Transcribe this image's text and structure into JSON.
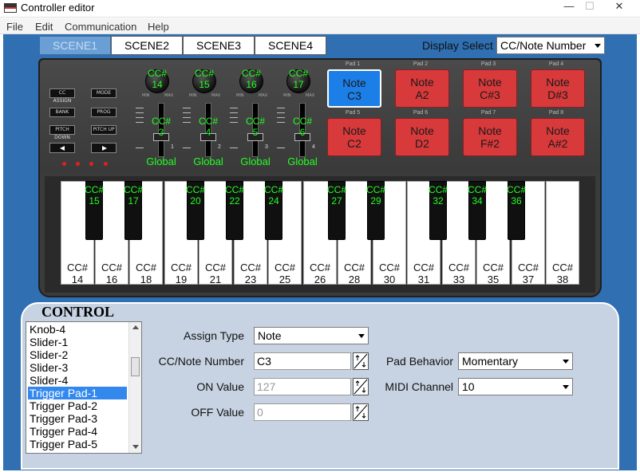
{
  "window": {
    "title": "Controller editor",
    "minimize": "—",
    "maximize": "☐",
    "close": "✕"
  },
  "menu": [
    "File",
    "Edit",
    "Communication",
    "Help"
  ],
  "scenes": [
    "SCENE1",
    "SCENE2",
    "SCENE3",
    "SCENE4"
  ],
  "display_select": {
    "label": "Display Select",
    "value": "CC/Note Number"
  },
  "device": {
    "buttons": [
      "CC ASSIGN",
      "MODE",
      "BANK",
      "PROG",
      "PITCH DOWN",
      "PITCH UP"
    ],
    "knobs": [
      {
        "cc": "CC#",
        "num": "14"
      },
      {
        "cc": "CC#",
        "num": "15"
      },
      {
        "cc": "CC#",
        "num": "16"
      },
      {
        "cc": "CC#",
        "num": "17"
      }
    ],
    "knob_minmax": {
      "min": "MIN",
      "max": "MAX"
    },
    "sliders": [
      {
        "cc": "CC#",
        "num": "3",
        "global": "Global",
        "index": "1"
      },
      {
        "cc": "CC#",
        "num": "4",
        "global": "Global",
        "index": "2"
      },
      {
        "cc": "CC#",
        "num": "5",
        "global": "Global",
        "index": "3"
      },
      {
        "cc": "CC#",
        "num": "6",
        "global": "Global",
        "index": "4"
      }
    ],
    "pads": [
      {
        "label": "Pad 1",
        "l1": "Note",
        "l2": "C3",
        "active": true
      },
      {
        "label": "Pad 2",
        "l1": "Note",
        "l2": "A2",
        "active": false
      },
      {
        "label": "Pad 3",
        "l1": "Note",
        "l2": "C#3",
        "active": false
      },
      {
        "label": "Pad 4",
        "l1": "Note",
        "l2": "D#3",
        "active": false
      },
      {
        "label": "Pad 5",
        "l1": "Note",
        "l2": "C2",
        "active": false
      },
      {
        "label": "Pad 6",
        "l1": "Note",
        "l2": "D2",
        "active": false
      },
      {
        "label": "Pad 7",
        "l1": "Note",
        "l2": "F#2",
        "active": false
      },
      {
        "label": "Pad 8",
        "l1": "Note",
        "l2": "A#2",
        "active": false
      }
    ],
    "white_keys": [
      {
        "cc": "CC#",
        "num": "14"
      },
      {
        "cc": "CC#",
        "num": "16"
      },
      {
        "cc": "CC#",
        "num": "18"
      },
      {
        "cc": "CC#",
        "num": "19"
      },
      {
        "cc": "CC#",
        "num": "21"
      },
      {
        "cc": "CC#",
        "num": "23"
      },
      {
        "cc": "CC#",
        "num": "25"
      },
      {
        "cc": "CC#",
        "num": "26"
      },
      {
        "cc": "CC#",
        "num": "28"
      },
      {
        "cc": "CC#",
        "num": "30"
      },
      {
        "cc": "CC#",
        "num": "31"
      },
      {
        "cc": "CC#",
        "num": "33"
      },
      {
        "cc": "CC#",
        "num": "35"
      },
      {
        "cc": "CC#",
        "num": "37"
      },
      {
        "cc": "CC#",
        "num": "38"
      }
    ],
    "black_keys": [
      {
        "cc": "CC#",
        "num": "15"
      },
      {
        "cc": "CC#",
        "num": "17"
      },
      {
        "cc": "CC#",
        "num": "20"
      },
      {
        "cc": "CC#",
        "num": "22"
      },
      {
        "cc": "CC#",
        "num": "24"
      },
      {
        "cc": "CC#",
        "num": "27"
      },
      {
        "cc": "CC#",
        "num": "29"
      },
      {
        "cc": "CC#",
        "num": "32"
      },
      {
        "cc": "CC#",
        "num": "34"
      },
      {
        "cc": "CC#",
        "num": "36"
      }
    ]
  },
  "control": {
    "title": "CONTROL",
    "list": [
      "Knob-4",
      "Slider-1",
      "Slider-2",
      "Slider-3",
      "Slider-4",
      "Trigger Pad-1",
      "Trigger Pad-2",
      "Trigger Pad-3",
      "Trigger Pad-4",
      "Trigger Pad-5"
    ],
    "selected": "Trigger Pad-1",
    "assign_type": {
      "label": "Assign Type",
      "value": "Note"
    },
    "cc_note": {
      "label": "CC/Note Number",
      "value": "C3"
    },
    "on_value": {
      "label": "ON Value",
      "value": "127"
    },
    "off_value": {
      "label": "OFF Value",
      "value": "0"
    },
    "pad_behavior": {
      "label": "Pad Behavior",
      "value": "Momentary"
    },
    "midi_channel": {
      "label": "MIDI Channel",
      "value": "10"
    }
  }
}
